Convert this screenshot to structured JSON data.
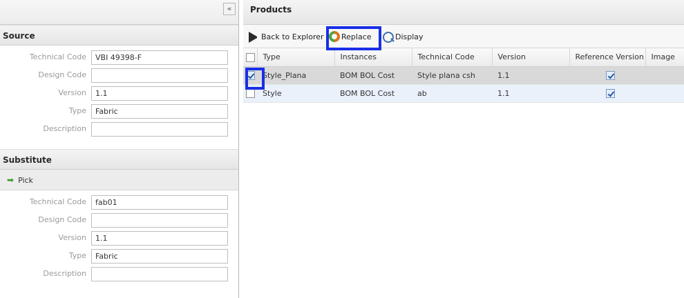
{
  "left": {
    "collapse_glyph": "«",
    "source": {
      "title": "Source",
      "fields": [
        {
          "label": "Technical Code",
          "value": "VBI 49398-F"
        },
        {
          "label": "Design Code",
          "value": ""
        },
        {
          "label": "Version",
          "value": "1.1"
        },
        {
          "label": "Type",
          "value": "Fabric"
        },
        {
          "label": "Description",
          "value": ""
        }
      ]
    },
    "substitute": {
      "title": "Substitute",
      "pick_label": "Pick",
      "fields": [
        {
          "label": "Technical Code",
          "value": "fab01"
        },
        {
          "label": "Design Code",
          "value": ""
        },
        {
          "label": "Version",
          "value": "1.1"
        },
        {
          "label": "Type",
          "value": "Fabric"
        },
        {
          "label": "Description",
          "value": ""
        }
      ]
    }
  },
  "products": {
    "title": "Products",
    "toolbar": {
      "back_label": "Back to Explorer",
      "replace_label": "Replace",
      "display_label": "Display"
    },
    "columns": [
      "Type",
      "Instances",
      "Technical Code",
      "Version",
      "Reference Version",
      "Image"
    ],
    "rows": [
      {
        "checked": true,
        "type": "Style_Plana",
        "instances": "BOM BOL Cost",
        "technical_code": "Style plana csh",
        "version": "1.1",
        "reference_version": true,
        "image": ""
      },
      {
        "checked": false,
        "type": "Style",
        "instances": "BOM BOL Cost",
        "technical_code": "ab",
        "version": "1.1",
        "reference_version": true,
        "image": ""
      }
    ]
  },
  "colors": {
    "highlight": "#1a2ee6",
    "link": "#2e6fc0",
    "selected_row": "#d9d9d9",
    "alt_row": "#eaf1fb"
  }
}
